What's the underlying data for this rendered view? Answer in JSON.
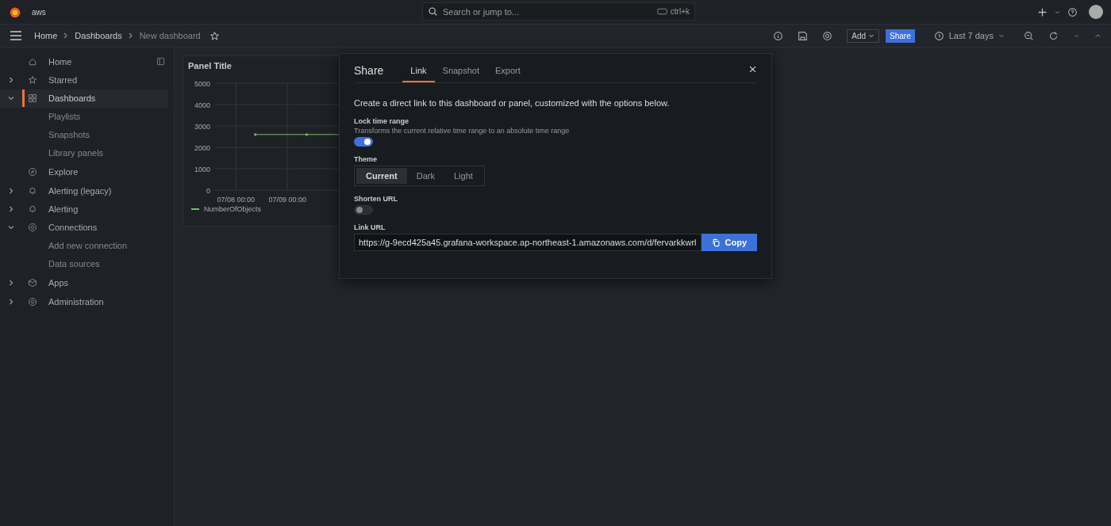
{
  "topbar": {
    "brand": "aws",
    "search": {
      "placeholder": "Search or jump to...",
      "shortcut": "ctrl+k"
    }
  },
  "breadcrumbs": [
    {
      "label": "Home",
      "current": false
    },
    {
      "label": "Dashboards",
      "current": false
    },
    {
      "label": "New dashboard",
      "current": true
    }
  ],
  "toolbar": {
    "add": "Add",
    "share": "Share",
    "time_range": "Last 7 days"
  },
  "sidebar": {
    "items": [
      {
        "label": "Home",
        "selected": false
      },
      {
        "label": "Starred",
        "expanded": false,
        "selected": false
      },
      {
        "label": "Dashboards",
        "expanded": true,
        "selected": true,
        "children": [
          {
            "label": "Playlists"
          },
          {
            "label": "Snapshots"
          },
          {
            "label": "Library panels"
          }
        ]
      },
      {
        "label": "Explore",
        "selected": false
      },
      {
        "label": "Alerting (legacy)",
        "expanded": false,
        "selected": false
      },
      {
        "label": "Alerting",
        "expanded": false,
        "selected": false
      },
      {
        "label": "Connections",
        "expanded": true,
        "selected": false,
        "children": [
          {
            "label": "Add new connection"
          },
          {
            "label": "Data sources"
          }
        ]
      },
      {
        "label": "Apps",
        "expanded": false,
        "selected": false
      },
      {
        "label": "Administration",
        "expanded": false,
        "selected": false
      }
    ]
  },
  "panel": {
    "title": "Panel Title",
    "chart_data": {
      "type": "line",
      "categories": [
        null,
        null,
        null,
        "07/08 00:00",
        null,
        null,
        null,
        null,
        null,
        null,
        null,
        "07/09 00:00",
        null,
        null,
        null,
        null,
        null,
        null,
        null,
        null
      ],
      "series": [
        {
          "name": "NumberOfObjects",
          "color": "#73bf69",
          "values": [
            null,
            null,
            null,
            null,
            null,
            null,
            2600,
            null,
            null,
            null,
            null,
            null,
            null,
            null,
            2600,
            null,
            null,
            null,
            null,
            2600
          ]
        }
      ],
      "ylim": [
        0,
        5000
      ],
      "grid": true,
      "yticks": [
        0,
        1000,
        2000,
        3000,
        4000,
        5000
      ]
    }
  },
  "modal": {
    "title": "Share",
    "tabs": [
      {
        "label": "Link",
        "selected": true
      },
      {
        "label": "Snapshot",
        "selected": false
      },
      {
        "label": "Export",
        "selected": false
      }
    ],
    "intro": "Create a direct link to this dashboard or panel, customized with the options below.",
    "lock": {
      "label": "Lock time range",
      "description": "Transforms the current relative time range to an absolute time range",
      "on": true
    },
    "theme": {
      "label": "Theme",
      "options": [
        {
          "label": "Current",
          "selected": true
        },
        {
          "label": "Dark",
          "selected": false
        },
        {
          "label": "Light",
          "selected": false
        }
      ]
    },
    "shorten": {
      "label": "Shorten URL",
      "on": false
    },
    "link": {
      "label": "Link URL",
      "value": "https://g-9ecd425a45.grafana-workspace.ap-northeast-1.amazonaws.com/d/fervarkkwrl",
      "copy": "Copy"
    }
  }
}
